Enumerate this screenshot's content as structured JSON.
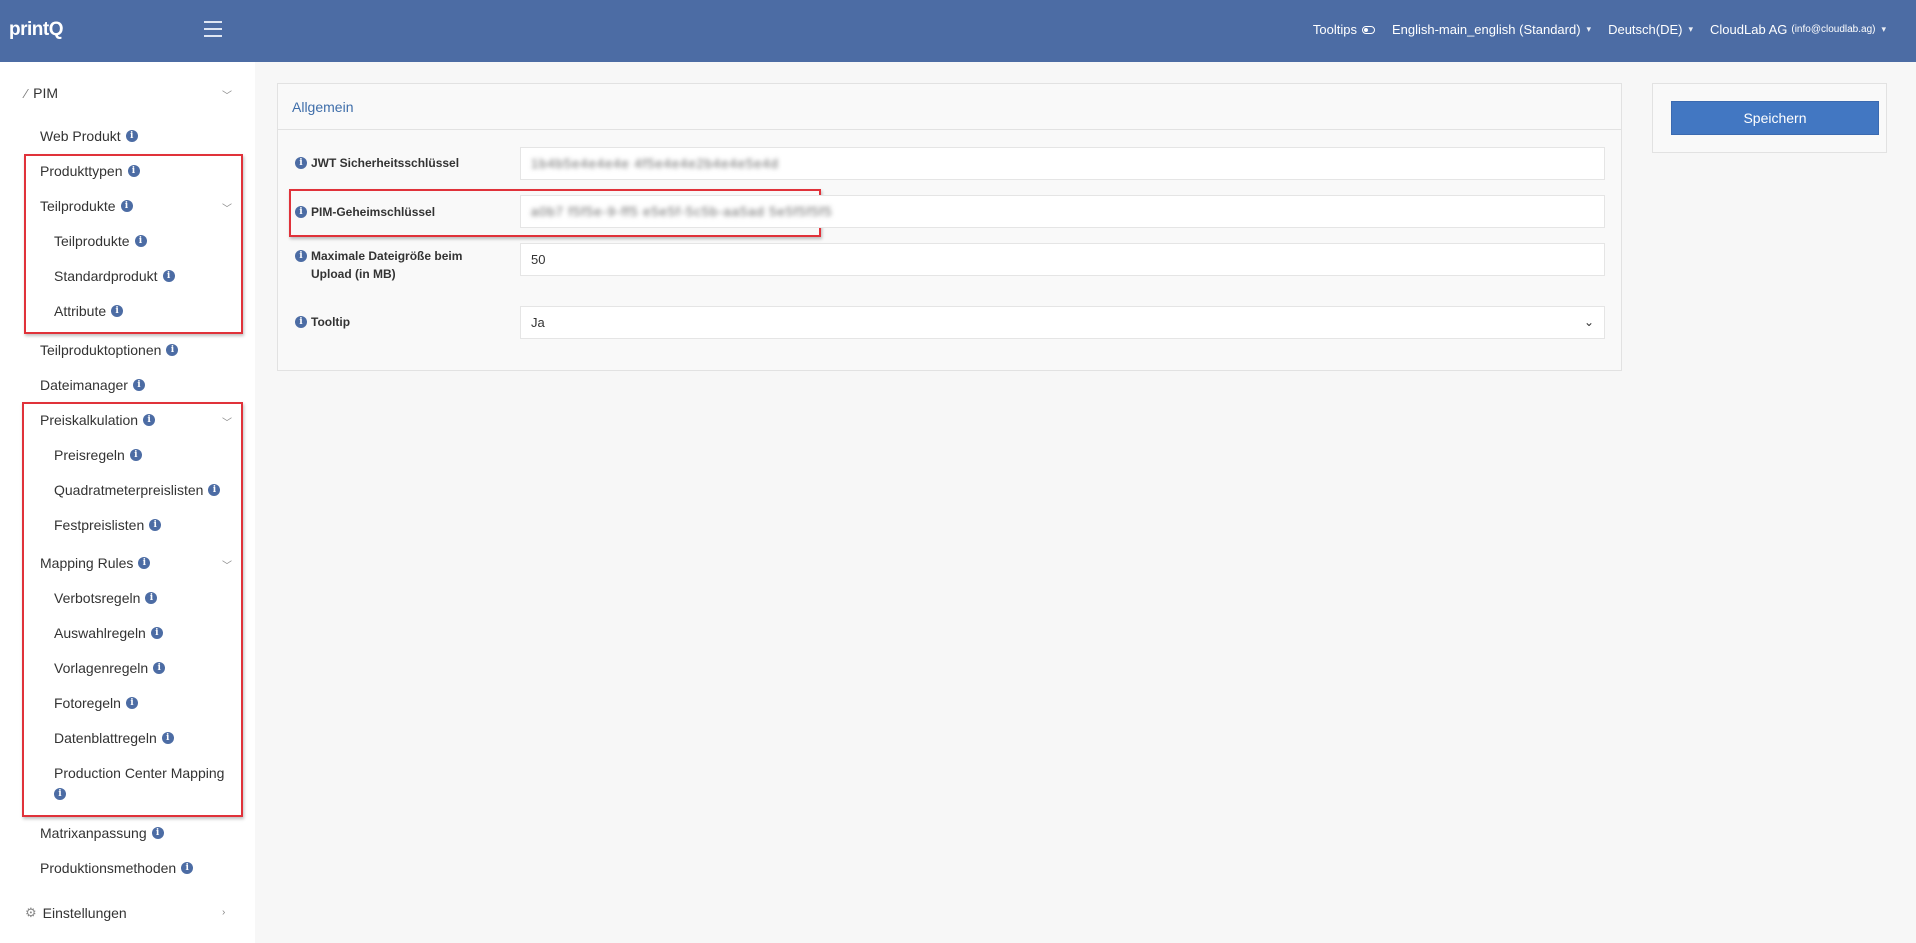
{
  "app": {
    "logo": "printQ"
  },
  "topbar": {
    "tooltips_label": "Tooltips",
    "language_main": "English-main_english (Standard)",
    "locale": "Deutsch(DE)",
    "account_name": "CloudLab AG",
    "account_email": "(info@cloudlab.ag)"
  },
  "sidebar": {
    "pim": "PIM",
    "web_produkt": "Web Produkt",
    "produkttypen": "Produkttypen",
    "teilprodukte_group": "Teilprodukte",
    "teilprodukte": "Teilprodukte",
    "standardprodukt": "Standardprodukt",
    "attribute": "Attribute",
    "teilproduktoptionen": "Teilproduktoptionen",
    "dateimanager": "Dateimanager",
    "preiskalkulation": "Preiskalkulation",
    "preisregeln": "Preisregeln",
    "quadratmeterpreislisten": "Quadratmeterpreislisten",
    "festpreislisten": "Festpreislisten",
    "mapping_rules": "Mapping Rules",
    "verbotsregeln": "Verbotsregeln",
    "auswahlregeln": "Auswahlregeln",
    "vorlagenregeln": "Vorlagenregeln",
    "fotoregeln": "Fotoregeln",
    "datenblattregeln": "Datenblattregeln",
    "production_center_mapping": "Production Center Mapping",
    "matrixanpassung": "Matrixanpassung",
    "produktionsmethoden": "Produktionsmethoden",
    "einstellungen": "Einstellungen"
  },
  "form": {
    "section_title": "Allgemein",
    "jwt_label": "JWT Sicherheitsschlüssel",
    "jwt_value": "1b4b5e4e4e4e 4f5e4e4e2b4e4e5e4d",
    "pim_label": "PIM-Geheimschlüssel",
    "pim_value": "a0b7 f5f5e-9-ff5 e5e5f-5c5b-aa5ad 5e5f5f5f5",
    "maxsize_label": "Maximale Dateigröße beim Upload (in MB)",
    "maxsize_value": "50",
    "tooltip_label": "Tooltip",
    "tooltip_value": "Ja"
  },
  "actions": {
    "save": "Speichern"
  },
  "colors": {
    "header": "#4c6ca4",
    "accent": "#4277c2",
    "highlight": "#e0323a"
  }
}
